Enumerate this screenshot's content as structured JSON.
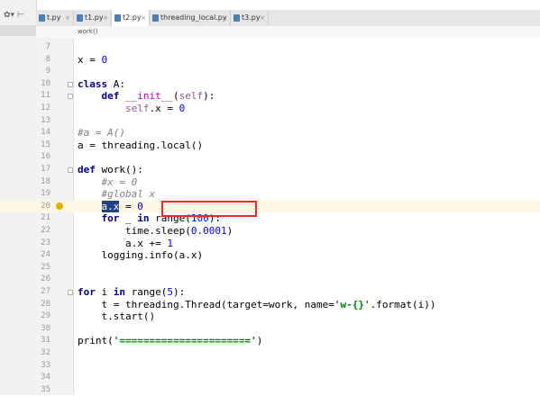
{
  "toolbar": {
    "settings_glyph": "✿▾ ⊢"
  },
  "tabs": [
    {
      "label": "t.py",
      "active": false
    },
    {
      "label": "t1.py",
      "active": false
    },
    {
      "label": "t2.py",
      "active": true
    },
    {
      "label": "threading_local.py",
      "active": false
    },
    {
      "label": "t3.py",
      "active": false
    }
  ],
  "breadcrumb": "work()",
  "lines": [
    {
      "n": "7",
      "text": ""
    },
    {
      "n": "8",
      "text": "x = 0"
    },
    {
      "n": "9",
      "text": ""
    },
    {
      "n": "10",
      "text": "class A:"
    },
    {
      "n": "11",
      "text": "    def __init__(self):"
    },
    {
      "n": "12",
      "text": "        self.x = 0"
    },
    {
      "n": "13",
      "text": ""
    },
    {
      "n": "14",
      "text": "#a = A()"
    },
    {
      "n": "15",
      "text": "a = threading.local()"
    },
    {
      "n": "16",
      "text": ""
    },
    {
      "n": "17",
      "text": "def work():"
    },
    {
      "n": "18",
      "text": "    #x = 0"
    },
    {
      "n": "19",
      "text": "    #global x"
    },
    {
      "n": "20",
      "text": "    a.x = 0"
    },
    {
      "n": "21",
      "text": "    for _ in range(100):"
    },
    {
      "n": "22",
      "text": "        time.sleep(0.0001)"
    },
    {
      "n": "23",
      "text": "        a.x += 1"
    },
    {
      "n": "24",
      "text": "    logging.info(a.x)"
    },
    {
      "n": "25",
      "text": ""
    },
    {
      "n": "26",
      "text": ""
    },
    {
      "n": "27",
      "text": "for i in range(5):"
    },
    {
      "n": "28",
      "text": "    t = threading.Thread(target=work, name='w-{}'.format(i))"
    },
    {
      "n": "29",
      "text": "    t.start()"
    },
    {
      "n": "30",
      "text": ""
    },
    {
      "n": "31",
      "text": "print('======================')"
    },
    {
      "n": "32",
      "text": ""
    },
    {
      "n": "33",
      "text": ""
    },
    {
      "n": "34",
      "text": ""
    },
    {
      "n": "35",
      "text": ""
    }
  ],
  "colors": {
    "keyword": "#000080",
    "number": "#0000ff",
    "string": "#008000",
    "comment": "#808080",
    "selection": "#214283",
    "annotation_box": "#e32d2d"
  }
}
